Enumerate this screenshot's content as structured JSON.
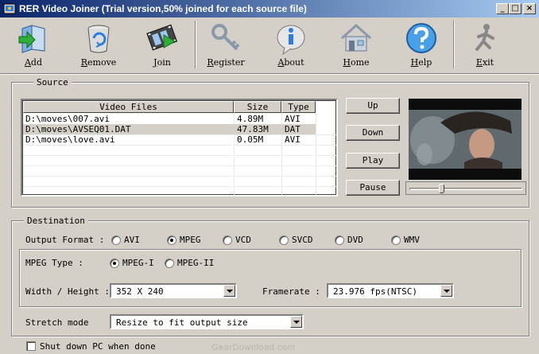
{
  "window": {
    "title": "RER Video Joiner (Trial version,50% joined for each source file)",
    "minimize_icon": "minimize-icon",
    "maximize_icon": "maximize-icon",
    "close_icon": "close-icon"
  },
  "toolbar": {
    "add": "Add",
    "remove": "Remove",
    "join": "Join",
    "register": "Register",
    "about": "About",
    "home": "Home",
    "help": "Help",
    "exit": "Exit"
  },
  "source": {
    "title": "Source",
    "columns": [
      "Video Files",
      "Size",
      "Type"
    ],
    "rows": [
      {
        "file": "D:\\moves\\007.avi",
        "size": "4.89M",
        "type": "AVI"
      },
      {
        "file": "D:\\moves\\AVSEQ01.DAT",
        "size": "47.83M",
        "type": "DAT"
      },
      {
        "file": "D:\\moves\\love.avi",
        "size": "0.05M",
        "type": "AVI"
      }
    ],
    "buttons": {
      "up": "Up",
      "down": "Down",
      "play": "Play",
      "pause": "Pause"
    },
    "slider_position": 0.27
  },
  "destination": {
    "title": "Destination",
    "output_format_label": "Output Format :",
    "formats": [
      "AVI",
      "MPEG",
      "VCD",
      "SVCD",
      "DVD",
      "WMV"
    ],
    "selected_format": "MPEG",
    "mpeg_type_label": "MPEG Type :",
    "mpeg_types": [
      "MPEG-I",
      "MPEG-II"
    ],
    "selected_mpeg_type": "MPEG-I",
    "width_height_label": "Width / Height :",
    "width_height_value": "352 X 240",
    "framerate_label": "Framerate :",
    "framerate_value": "23.976 fps(NTSC)",
    "stretch_label": "Stretch mode",
    "stretch_value": "Resize to fit output size"
  },
  "shutdown_label": "Shut down PC when done",
  "watermark": "GearDownload.com"
}
